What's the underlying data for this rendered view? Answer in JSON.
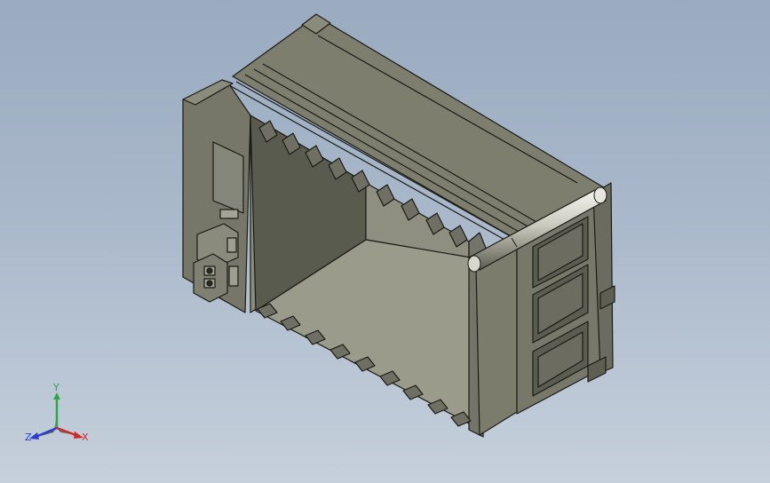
{
  "viewport": {
    "background_top": "#9aabc0",
    "background_bottom": "#c6d0dc"
  },
  "model": {
    "icon": "plc-rack-chassis",
    "body_color": "#7b7c6c",
    "dark_interior_color": "#55564a",
    "edge_color": "#1b1b16",
    "slot_count": 9
  },
  "triad": {
    "x_label": "X",
    "y_label": "Y",
    "z_label": "Z",
    "x_color": "#d0282a",
    "y_color": "#2aa84a",
    "z_color": "#2a3fd0"
  }
}
